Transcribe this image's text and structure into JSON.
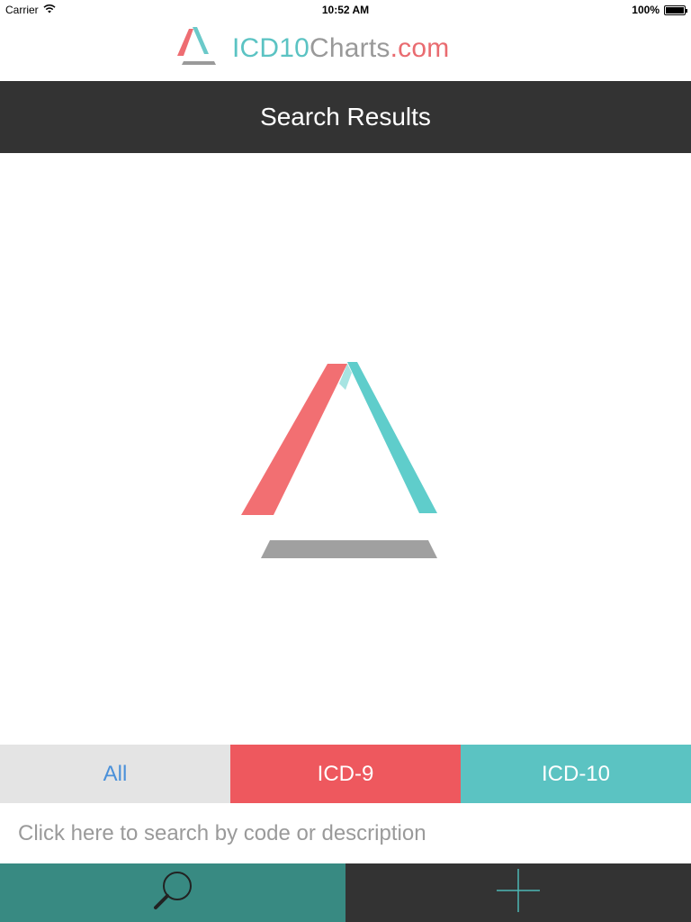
{
  "status_bar": {
    "carrier": "Carrier",
    "time": "10:52 AM",
    "battery_percent": "100%",
    "battery_level": 1.0
  },
  "header": {
    "logo_icon": "icd10charts-logo-icon",
    "brand_icd": "ICD10",
    "brand_charts": "Charts",
    "brand_dot": ".com"
  },
  "title_bar": {
    "title": "Search Results"
  },
  "filter_tabs": {
    "all_label": "All",
    "icd9_label": "ICD-9",
    "icd10_label": "ICD-10",
    "selected": "All"
  },
  "search": {
    "placeholder": "Click here to search by code or description",
    "value": ""
  },
  "bottom_bar": {
    "search_icon": "search-icon",
    "add_icon": "plus-icon"
  },
  "colors": {
    "brand_teal": "#5bc3c3",
    "brand_red": "#ee585e",
    "brand_gray": "#999999",
    "dark_bar": "#333333",
    "search_button_bg": "#388a82"
  }
}
